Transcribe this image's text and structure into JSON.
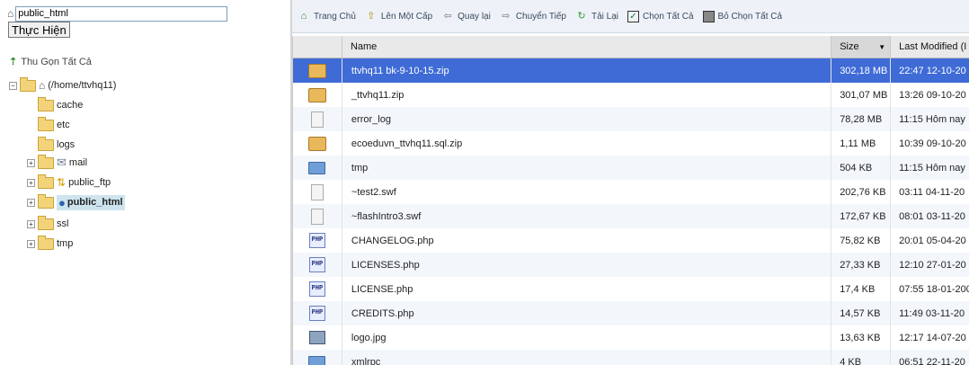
{
  "left": {
    "path_value": "public_html",
    "go_label": "Thực Hiện",
    "collapse_label": "Thu Gọn Tất Cả",
    "root_label": "(/home/ttvhq11)",
    "tree": [
      {
        "label": "cache",
        "icon": "folder-icon",
        "expandable": false
      },
      {
        "label": "etc",
        "icon": "folder-icon",
        "expandable": false
      },
      {
        "label": "logs",
        "icon": "folder-icon",
        "expandable": false
      },
      {
        "label": "mail",
        "icon": "mail-folder-icon",
        "expandable": true
      },
      {
        "label": "public_ftp",
        "icon": "ftp-folder-icon",
        "expandable": true
      },
      {
        "label": "public_html",
        "icon": "globe-folder-icon",
        "expandable": true,
        "selected": true
      },
      {
        "label": "ssl",
        "icon": "folder-icon",
        "expandable": true
      },
      {
        "label": "tmp",
        "icon": "folder-icon",
        "expandable": true
      }
    ]
  },
  "toolbar": [
    {
      "label": "Trang Chủ",
      "icon": "home-icon"
    },
    {
      "label": "Lên Một Cấp",
      "icon": "up-level-icon"
    },
    {
      "label": "Quay lại",
      "icon": "back-arrow-icon"
    },
    {
      "label": "Chuyển Tiếp",
      "icon": "forward-arrow-icon"
    },
    {
      "label": "Tải Lại",
      "icon": "reload-icon"
    },
    {
      "label": "Chọn Tất Cả",
      "icon": "check-all-icon"
    },
    {
      "label": "Bỏ Chọn Tất Cả",
      "icon": "uncheck-all-icon"
    }
  ],
  "grid": {
    "headers": {
      "name": "Name",
      "size": "Size",
      "date": "Last Modified (I"
    },
    "sort_indicator": "▼",
    "rows": [
      {
        "icon": "zip",
        "name": "ttvhq11 bk-9-10-15.zip",
        "size": "302,18 MB",
        "date": "22:47 12-10-20",
        "selected": true
      },
      {
        "icon": "zip",
        "name": "_ttvhq11.zip",
        "size": "301,07 MB",
        "date": "13:26 09-10-20"
      },
      {
        "icon": "file",
        "name": "error_log",
        "size": "78,28 MB",
        "date": "11:15 Hôm nay"
      },
      {
        "icon": "zip",
        "name": "ecoeduvn_ttvhq11.sql.zip",
        "size": "1,11 MB",
        "date": "10:39 09-10-20"
      },
      {
        "icon": "dir",
        "name": "tmp",
        "size": "504 KB",
        "date": "11:15 Hôm nay"
      },
      {
        "icon": "file",
        "name": "~test2.swf",
        "size": "202,76 KB",
        "date": "03:11 04-11-20"
      },
      {
        "icon": "file",
        "name": "~flashIntro3.swf",
        "size": "172,67 KB",
        "date": "08:01 03-11-20"
      },
      {
        "icon": "php",
        "name": "CHANGELOG.php",
        "size": "75,82 KB",
        "date": "20:01 05-04-20"
      },
      {
        "icon": "php",
        "name": "LICENSES.php",
        "size": "27,33 KB",
        "date": "12:10 27-01-20"
      },
      {
        "icon": "php",
        "name": "LICENSE.php",
        "size": "17,4 KB",
        "date": "07:55 18-01-200"
      },
      {
        "icon": "php",
        "name": "CREDITS.php",
        "size": "14,57 KB",
        "date": "11:49 03-11-20"
      },
      {
        "icon": "img",
        "name": "logo.jpg",
        "size": "13,63 KB",
        "date": "12:17 14-07-20"
      },
      {
        "icon": "dir",
        "name": "xmlrpc",
        "size": "4 KB",
        "date": "06:51 22-11-20"
      }
    ]
  },
  "colors": {
    "selected_row": "#3f6bd6",
    "toolbar_bg": "#eef2f8",
    "tree_selected": "#cde4ef"
  }
}
